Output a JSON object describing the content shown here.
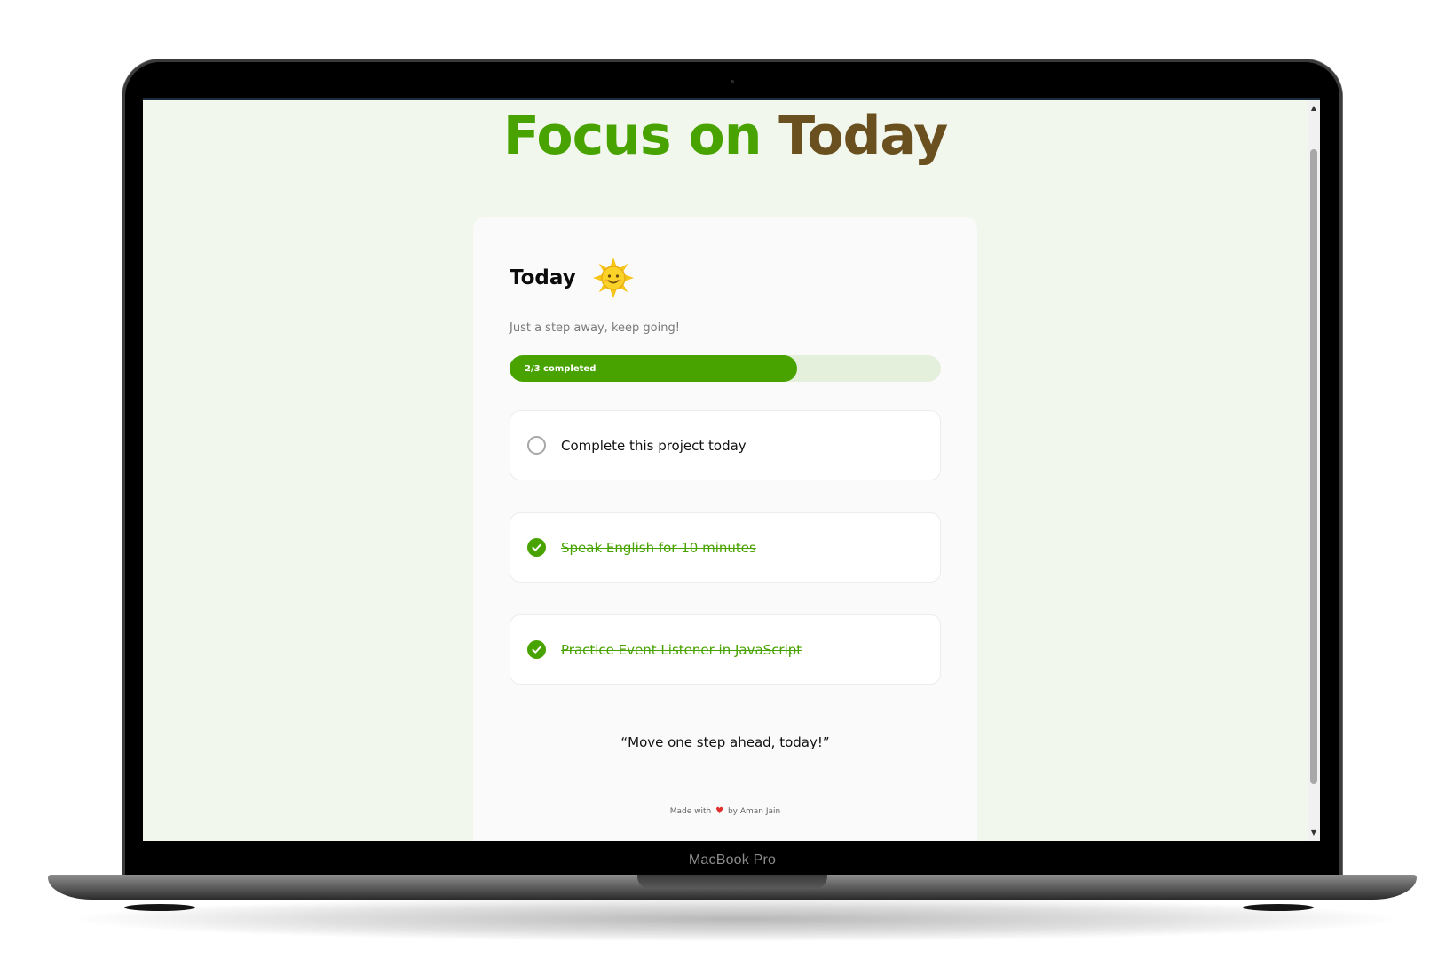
{
  "device": {
    "label": "MacBook Pro"
  },
  "page": {
    "heading_part1": "Focus on",
    "heading_part2": "Today"
  },
  "card": {
    "title": "Today",
    "title_icon": "smiling-sun-icon",
    "subtitle": "Just a step away, keep going!",
    "progress": {
      "label": "2/3 completed",
      "completed": 2,
      "total": 3,
      "fraction": 0.667
    },
    "tasks": [
      {
        "label": "Complete this project today",
        "done": false
      },
      {
        "label": "Speak English for 10 minutes",
        "done": true
      },
      {
        "label": "Practice Event Listener in JavaScript",
        "done": true
      }
    ],
    "quote": "“Move one step ahead, today!”",
    "footer": {
      "made_with": "Made with",
      "heart_icon": "heart-icon",
      "by": "by Aman Jain"
    }
  },
  "colors": {
    "accent_green": "#48a300",
    "heading_brown": "#6a4f1f",
    "page_background": "#f1f7ec",
    "progress_track": "#e4f0dc",
    "heart": "#e0312f"
  }
}
